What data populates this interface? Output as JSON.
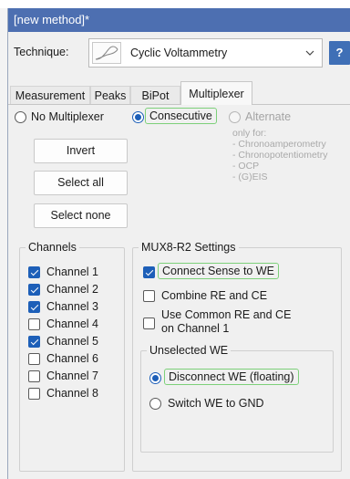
{
  "window": {
    "title": "[new method]*"
  },
  "technique": {
    "label": "Technique:",
    "selected": "Cyclic Voltammetry",
    "icon": "cyclic-voltammetry-icon",
    "help_label": "?"
  },
  "tabs": [
    {
      "label": "Measurement",
      "active": false
    },
    {
      "label": "Peaks",
      "active": false
    },
    {
      "label": "BiPot",
      "active": false
    },
    {
      "label": "Multiplexer",
      "active": true
    }
  ],
  "mode": {
    "options": [
      {
        "label": "No Multiplexer",
        "checked": false,
        "enabled": true
      },
      {
        "label": "Consecutive",
        "checked": true,
        "enabled": true
      },
      {
        "label": "Alternate",
        "checked": false,
        "enabled": false
      }
    ],
    "alternate_note": [
      "only for:",
      "- Chronoamperometry",
      "- Chronopotentiometry",
      "- OCP",
      "- (G)EIS"
    ]
  },
  "buttons": {
    "invert": "Invert",
    "select_all": "Select all",
    "select_none": "Select none"
  },
  "channels": {
    "title": "Channels",
    "items": [
      {
        "label": "Channel 1",
        "checked": true
      },
      {
        "label": "Channel 2",
        "checked": true
      },
      {
        "label": "Channel 3",
        "checked": true
      },
      {
        "label": "Channel 4",
        "checked": false
      },
      {
        "label": "Channel 5",
        "checked": true
      },
      {
        "label": "Channel 6",
        "checked": false
      },
      {
        "label": "Channel 7",
        "checked": false
      },
      {
        "label": "Channel 8",
        "checked": false
      }
    ]
  },
  "mux_settings": {
    "title": "MUX8-R2 Settings",
    "connect_sense": {
      "label": "Connect Sense to WE",
      "checked": true
    },
    "combine_re_ce": {
      "label": "Combine RE and CE",
      "checked": false
    },
    "common_re_ce": {
      "label_line1": "Use Common RE and CE",
      "label_line2": "on Channel 1",
      "checked": false
    },
    "unselected_we": {
      "title": "Unselected WE",
      "options": [
        {
          "label": "Disconnect WE (floating)",
          "checked": true
        },
        {
          "label": "Switch WE to GND",
          "checked": false
        }
      ]
    }
  },
  "colors": {
    "titlebar": "#4d6fb1",
    "accent": "#1d5fb8",
    "highlight": "#7dd07a"
  }
}
